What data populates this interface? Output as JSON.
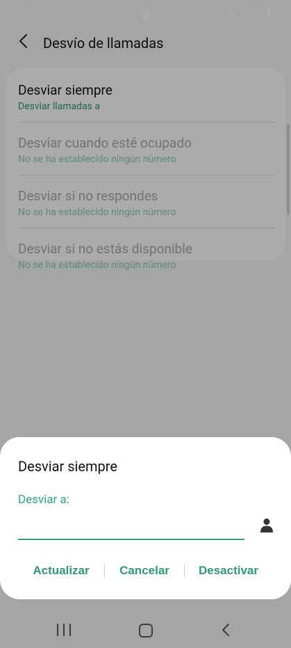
{
  "status_bar": {
    "time": "10:00",
    "battery": "100%"
  },
  "app_bar": {
    "title": "Desvío de llamadas",
    "back_icon": "chevron-left-icon"
  },
  "list": {
    "items": [
      {
        "title": "Desviar siempre",
        "subtitle": "Desviar llamadas a",
        "enabled": true
      },
      {
        "title": "Desviar cuando esté ocupado",
        "subtitle": "No se ha establecido ningún número",
        "enabled": false
      },
      {
        "title": "Desviar si no respondes",
        "subtitle": "No se ha establecido ningún número",
        "enabled": false
      },
      {
        "title": "Desviar si no estás disponible",
        "subtitle": "No se ha establecido ningún número",
        "enabled": false
      }
    ]
  },
  "dialog": {
    "title": "Desviar siempre",
    "field_label": "Desviar a:",
    "field_value": "",
    "contact_icon": "person-icon",
    "buttons": {
      "update": "Actualizar",
      "cancel": "Cancelar",
      "deactivate": "Desactivar"
    }
  },
  "nav_bar": {
    "recents_icon": "recents-icon",
    "home_icon": "home-icon",
    "back_icon": "back-icon"
  },
  "colors": {
    "accent": "#2e9a6e",
    "input_line": "#2ea77a"
  }
}
